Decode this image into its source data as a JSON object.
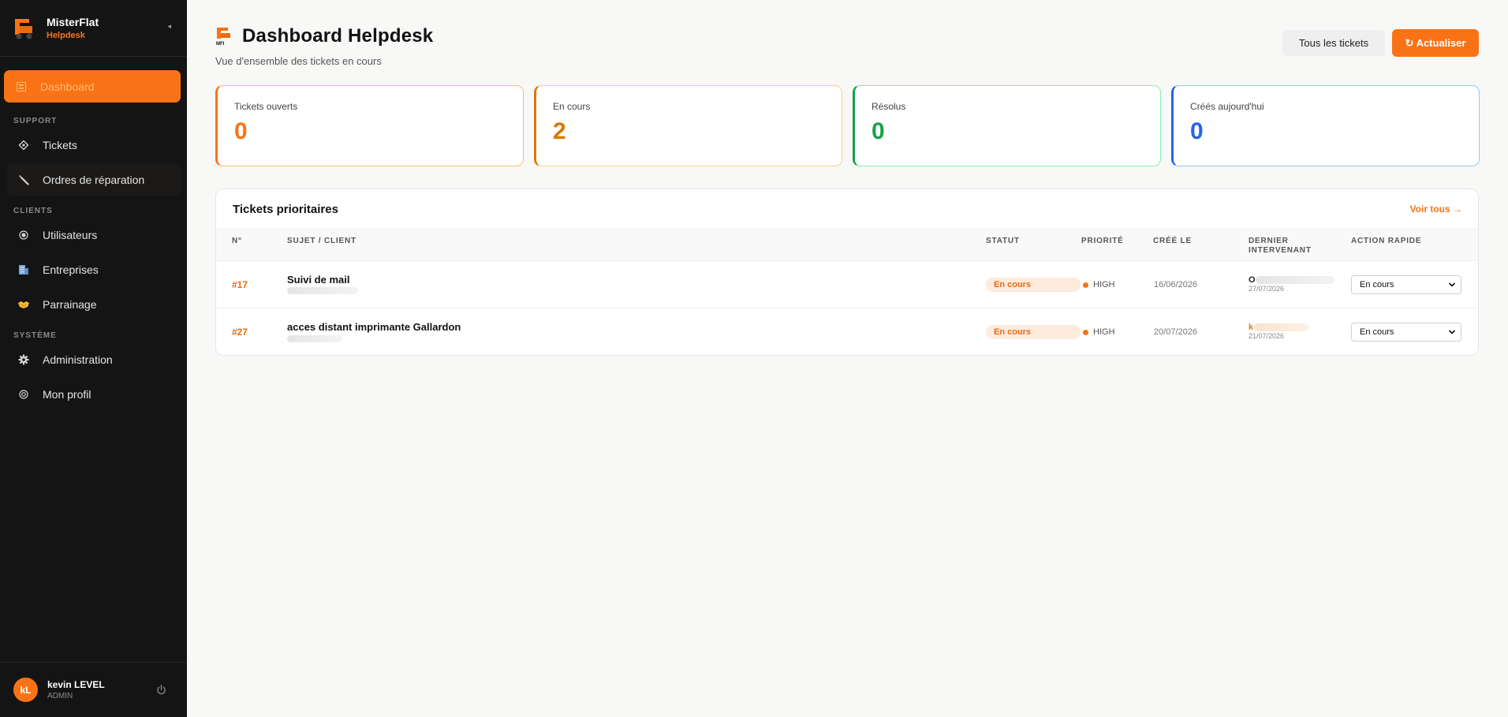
{
  "brand": {
    "name": "MisterFlat",
    "sub": "Helpdesk",
    "collapse_icon": "◂"
  },
  "nav": {
    "dashboard": "Dashboard",
    "section_support": "SUPPORT",
    "tickets": "Tickets",
    "repair_orders": "Ordres de réparation",
    "section_clients": "CLIENTS",
    "users": "Utilisateurs",
    "companies": "Entreprises",
    "referral": "Parrainage",
    "section_system": "SYSTÈME",
    "administration": "Administration",
    "profile": "Mon profil"
  },
  "user": {
    "initials": "kL",
    "name": "kevin LEVEL",
    "role": "ADMIN"
  },
  "header": {
    "title": "Dashboard Helpdesk",
    "subtitle": "Vue d'ensemble des tickets en cours",
    "all_tickets_label": "Tous les tickets",
    "refresh_label": "↻ Actualiser"
  },
  "stats": [
    {
      "label": "Tickets ouverts",
      "value": "0",
      "color": "#f97316"
    },
    {
      "label": "En cours",
      "value": "2",
      "color": "#d97706"
    },
    {
      "label": "Résolus",
      "value": "0",
      "color": "#16a34a"
    },
    {
      "label": "Créés aujourd'hui",
      "value": "0",
      "color": "#2563eb"
    }
  ],
  "priority_panel": {
    "title": "Tickets prioritaires",
    "see_all": "Voir tous →",
    "columns": [
      "N°",
      "SUJET / CLIENT",
      "STATUT",
      "PRIORITÉ",
      "CRÉÉ LE",
      "DERNIER INTERVENANT",
      "ACTION RAPIDE"
    ],
    "rows": [
      {
        "id": "#17",
        "subject": "Suivi de mail",
        "status": "En cours",
        "priority": "HIGH",
        "created": "16/06/2026",
        "last_agent": "O",
        "last_date": "27/07/2026",
        "action": "En cours"
      },
      {
        "id": "#27",
        "subject": "acces distant imprimante Gallardon",
        "status": "En cours",
        "priority": "HIGH",
        "created": "20/07/2026",
        "last_agent": "k",
        "last_date": "21/07/2026",
        "action": "En cours"
      }
    ]
  },
  "colors": {
    "accent": "#f97316",
    "sidebar_bg": "#141414",
    "page_bg": "#f8f8f7"
  }
}
